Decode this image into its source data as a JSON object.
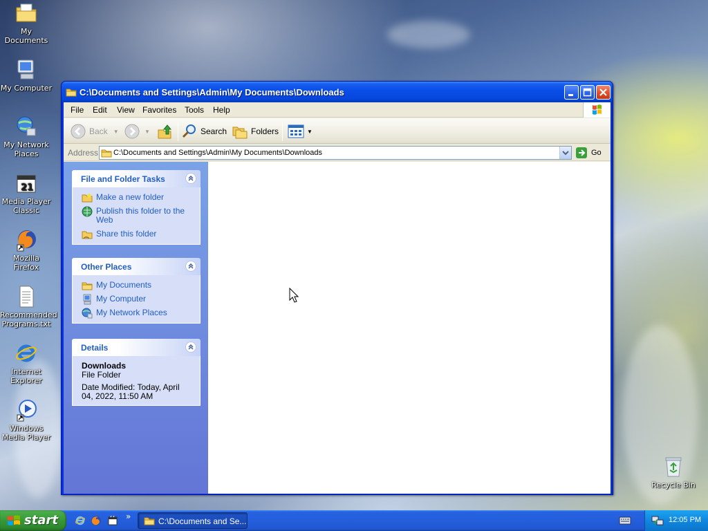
{
  "desktop": {
    "icons": [
      {
        "label": "My Documents",
        "icon": "folder-docs-icon"
      },
      {
        "label": "My Computer",
        "icon": "computer-icon"
      },
      {
        "label": "My Network Places",
        "icon": "network-icon"
      },
      {
        "label": "Media Player Classic",
        "icon": "media-player-classic-icon"
      },
      {
        "label": "Mozilla Firefox",
        "icon": "firefox-icon"
      },
      {
        "label": "Recommended Programs.txt",
        "icon": "text-file-icon"
      },
      {
        "label": "Internet Explorer",
        "icon": "ie-icon"
      },
      {
        "label": "Windows Media Player",
        "icon": "wmp-icon"
      },
      {
        "label": "Recycle Bin",
        "icon": "recycle-bin-icon"
      }
    ]
  },
  "window": {
    "title": "C:\\Documents and Settings\\Admin\\My Documents\\Downloads",
    "menu": [
      "File",
      "Edit",
      "View",
      "Favorites",
      "Tools",
      "Help"
    ],
    "toolbar": {
      "back": "Back",
      "search": "Search",
      "folders": "Folders"
    },
    "address": {
      "label": "Address",
      "value": "C:\\Documents and Settings\\Admin\\My Documents\\Downloads",
      "go": "Go"
    },
    "taskpane": {
      "file_tasks": {
        "title": "File and Folder Tasks",
        "items": [
          "Make a new folder",
          "Publish this folder to the Web",
          "Share this folder"
        ]
      },
      "other_places": {
        "title": "Other Places",
        "items": [
          "My Documents",
          "My Computer",
          "My Network Places"
        ]
      },
      "details": {
        "title": "Details",
        "name": "Downloads",
        "type": "File Folder",
        "modified": "Date Modified: Today, April 04, 2022, 11:50 AM"
      }
    }
  },
  "taskbar": {
    "start": "start",
    "task_button": "C:\\Documents and Se...",
    "overflow": "»",
    "clock": "12:05 PM"
  },
  "colors": {
    "xp_blue": "#0a4fe8",
    "task_link": "#215dc6",
    "start_green": "#389a38"
  }
}
